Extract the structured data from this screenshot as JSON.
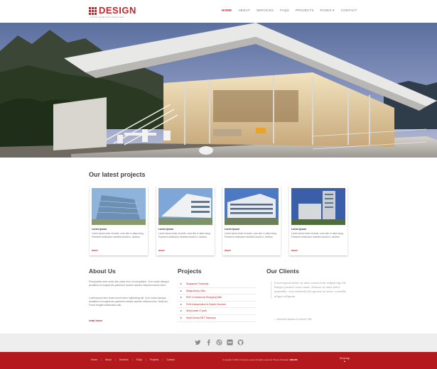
{
  "header": {
    "logo": "DESIGN",
    "tagline": "Another Heading Text Content Here",
    "nav": [
      "HOME",
      "ABOUT",
      "SERVICES",
      "FAQS",
      "PROJECTS",
      "PAGES ▾",
      "CONTACT"
    ],
    "active_nav": "HOME"
  },
  "latest_projects": {
    "title": "Our latest projects",
    "cards": [
      {
        "title": "Lorem Ipsum",
        "desc": "Lorem ipsum dolor sit amet, cons tetu er adipi scing. Praesent vestibulum molestie lacolit iro. Aenean.",
        "more": "more"
      },
      {
        "title": "Lorem Ipsum",
        "desc": "Lorem ipsum dolor sit amet, cons tetu er adipi scing. Praesent vestibulum molestie lacolit iro. Aenean.",
        "more": "more"
      },
      {
        "title": "Lorem Ipsum",
        "desc": "Lorem ipsum dolor sit amet, cons tetu er adipi scing. Praesent vestibulum molestie lacolit iro. Aenean.",
        "more": "more"
      },
      {
        "title": "Lorem Ipsum",
        "desc": "Lorem ipsum dolor sit amet, cons tetu er adipi scing. Praesent vestibulum molestie lacolit iro. Aenean.",
        "more": "more"
      }
    ]
  },
  "about": {
    "title": "About Us",
    "p1": "Perspiciatis unde omnis iste natus error sit voluptatem. Cum sociis natoque penatibus et magnis dis parturient montes ascetur ridiculus mauris dolor.",
    "p2": "Lorem ipsum dum amet conse ctetur adipisicing elit. Cum sociis natoque penatibus et magnis dis parturient montes ascetur ridiculus mus. Nulla dui. Fusce feugiat malesuada odio.",
    "more": "read more"
  },
  "projects_list": {
    "title": "Projects",
    "items": [
      "Singapore Township",
      "Mega luxury Villa",
      "RNT Commercial Shopping Mall",
      "SVN Independent & Duplex Houses",
      "World wide IT park",
      "North Arena 3NT Township"
    ]
  },
  "clients": {
    "title": "Our Clients",
    "quote": "Lorem ipsum dolor sit amet consectetur adipiscing elit. Integer posuere erat a ante. Aenean sit amet dolor imperdiet, cras euismod nisl egestas ut tortor convallis aliquet aliquam.",
    "author": "— Someone famous in Source Title"
  },
  "social_icons": [
    "twitter-icon",
    "facebook-icon",
    "dribbble-icon",
    "flickr-icon",
    "github-icon"
  ],
  "footer": {
    "nav": [
      "Home",
      "About",
      "Services",
      "FAQs",
      "Projects",
      "Contact"
    ],
    "copyright": "Copyright © 2014 Company name All rights reserved Theme Template:",
    "brand": "BRAND",
    "top": "Go to top"
  },
  "colors": {
    "accent": "#c0272d",
    "footer": "#b3191d",
    "social_bar": "#eeeeee"
  }
}
